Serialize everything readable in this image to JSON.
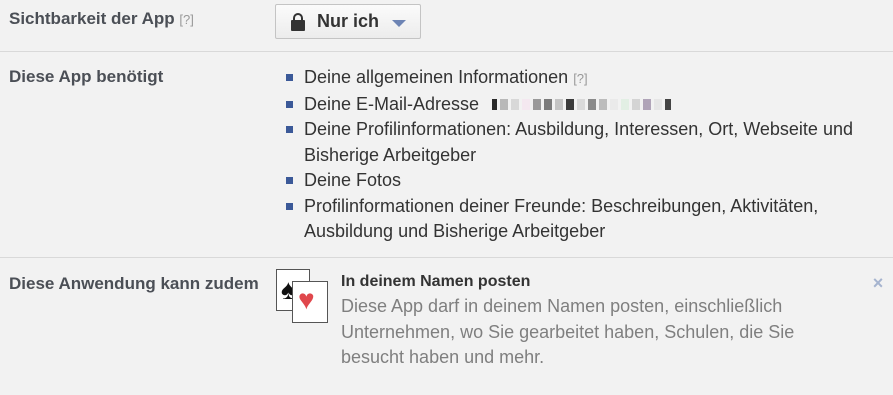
{
  "visibility": {
    "label": "Sichtbarkeit der App",
    "help": "[?]",
    "selector_value": "Nur ich",
    "selector_icon": "lock-icon"
  },
  "requires": {
    "label": "Diese App benötigt",
    "items": [
      {
        "text": "Deine allgemeinen Informationen",
        "help": "[?]"
      },
      {
        "text": "Deine E-Mail-Adresse"
      },
      {
        "text": "Deine Profilinformationen: Ausbildung, Interessen, Ort, Webseite und Bisherige Arbeitgeber"
      },
      {
        "text": "Deine Fotos"
      },
      {
        "text": "Profilinformationen deiner Freunde: Beschreibungen, Aktivitäten, Ausbildung und Bisherige Arbeitgeber"
      }
    ]
  },
  "also": {
    "label": "Diese Anwendung kann zudem",
    "permission_title": "In deinem Namen posten",
    "permission_desc": "Diese App darf in deinem Namen posten, einschließlich Unternehmen, wo Sie gearbeitet haben, Schulen, die Sie besucht haben und mehr.",
    "close_glyph": "×"
  },
  "colors": {
    "bullet": "#3b5998",
    "caret": "#6d84b4",
    "heart": "#e0474c"
  }
}
